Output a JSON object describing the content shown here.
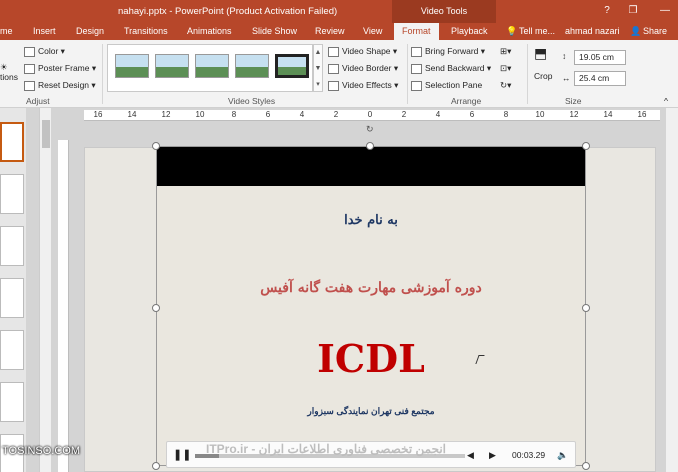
{
  "window": {
    "title": "nahayi.pptx - PowerPoint (Product Activation Failed)",
    "context_tab_group": "Video Tools",
    "controls": {
      "help": "?",
      "restore": "❐",
      "minimize": "—",
      "maximize": "□",
      "close": "✕"
    }
  },
  "tabs": [
    {
      "label": "me"
    },
    {
      "label": "Insert"
    },
    {
      "label": "Design"
    },
    {
      "label": "Transitions"
    },
    {
      "label": "Animations"
    },
    {
      "label": "Slide Show"
    },
    {
      "label": "Review"
    },
    {
      "label": "View"
    },
    {
      "label": "Format",
      "active": true
    },
    {
      "label": "Playback"
    }
  ],
  "tell_me": "Tell me...",
  "user": "ahmad nazari",
  "share": "Share",
  "ribbon": {
    "adjust": {
      "options_label": "tions",
      "color": "Color",
      "poster_frame": "Poster Frame",
      "reset_design": "Reset Design",
      "group": "Adjust"
    },
    "video_styles": {
      "video_shape": "Video Shape",
      "video_border": "Video Border",
      "video_effects": "Video Effects",
      "group": "Video Styles",
      "thumbnails": 5,
      "selected_index": 4
    },
    "arrange": {
      "bring_forward": "Bring Forward",
      "send_backward": "Send Backward",
      "selection_pane": "Selection Pane",
      "group": "Arrange"
    },
    "size": {
      "crop": "Crop",
      "height": "19.05 cm",
      "width": "25.4 cm",
      "group": "Size"
    }
  },
  "ruler": {
    "labels": [
      "16",
      "14",
      "12",
      "10",
      "8",
      "6",
      "4",
      "2",
      "0",
      "2",
      "4",
      "6",
      "8",
      "10",
      "12",
      "14",
      "16"
    ]
  },
  "slide": {
    "line1": "به نام خدا",
    "line2": "دوره آموزشی مهارت هفت گانه آفیس",
    "line3": "ICDL",
    "line4": "مجتمع فنی تهران نمایندگی سبزوار"
  },
  "player": {
    "pause": "❚❚",
    "rewind": "◀",
    "forward": "▶",
    "volume": "🔈",
    "time": "00:03.29",
    "progress": 0.09
  },
  "watermark": {
    "left": "TOSINSO.COM",
    "center": "ITPro.ir - انجمن تخصصی فناوری اطلاعات ایران"
  },
  "colors": {
    "accent": "#b7472a",
    "title_blue": "#1f3864",
    "icdl_red": "#c00000"
  }
}
